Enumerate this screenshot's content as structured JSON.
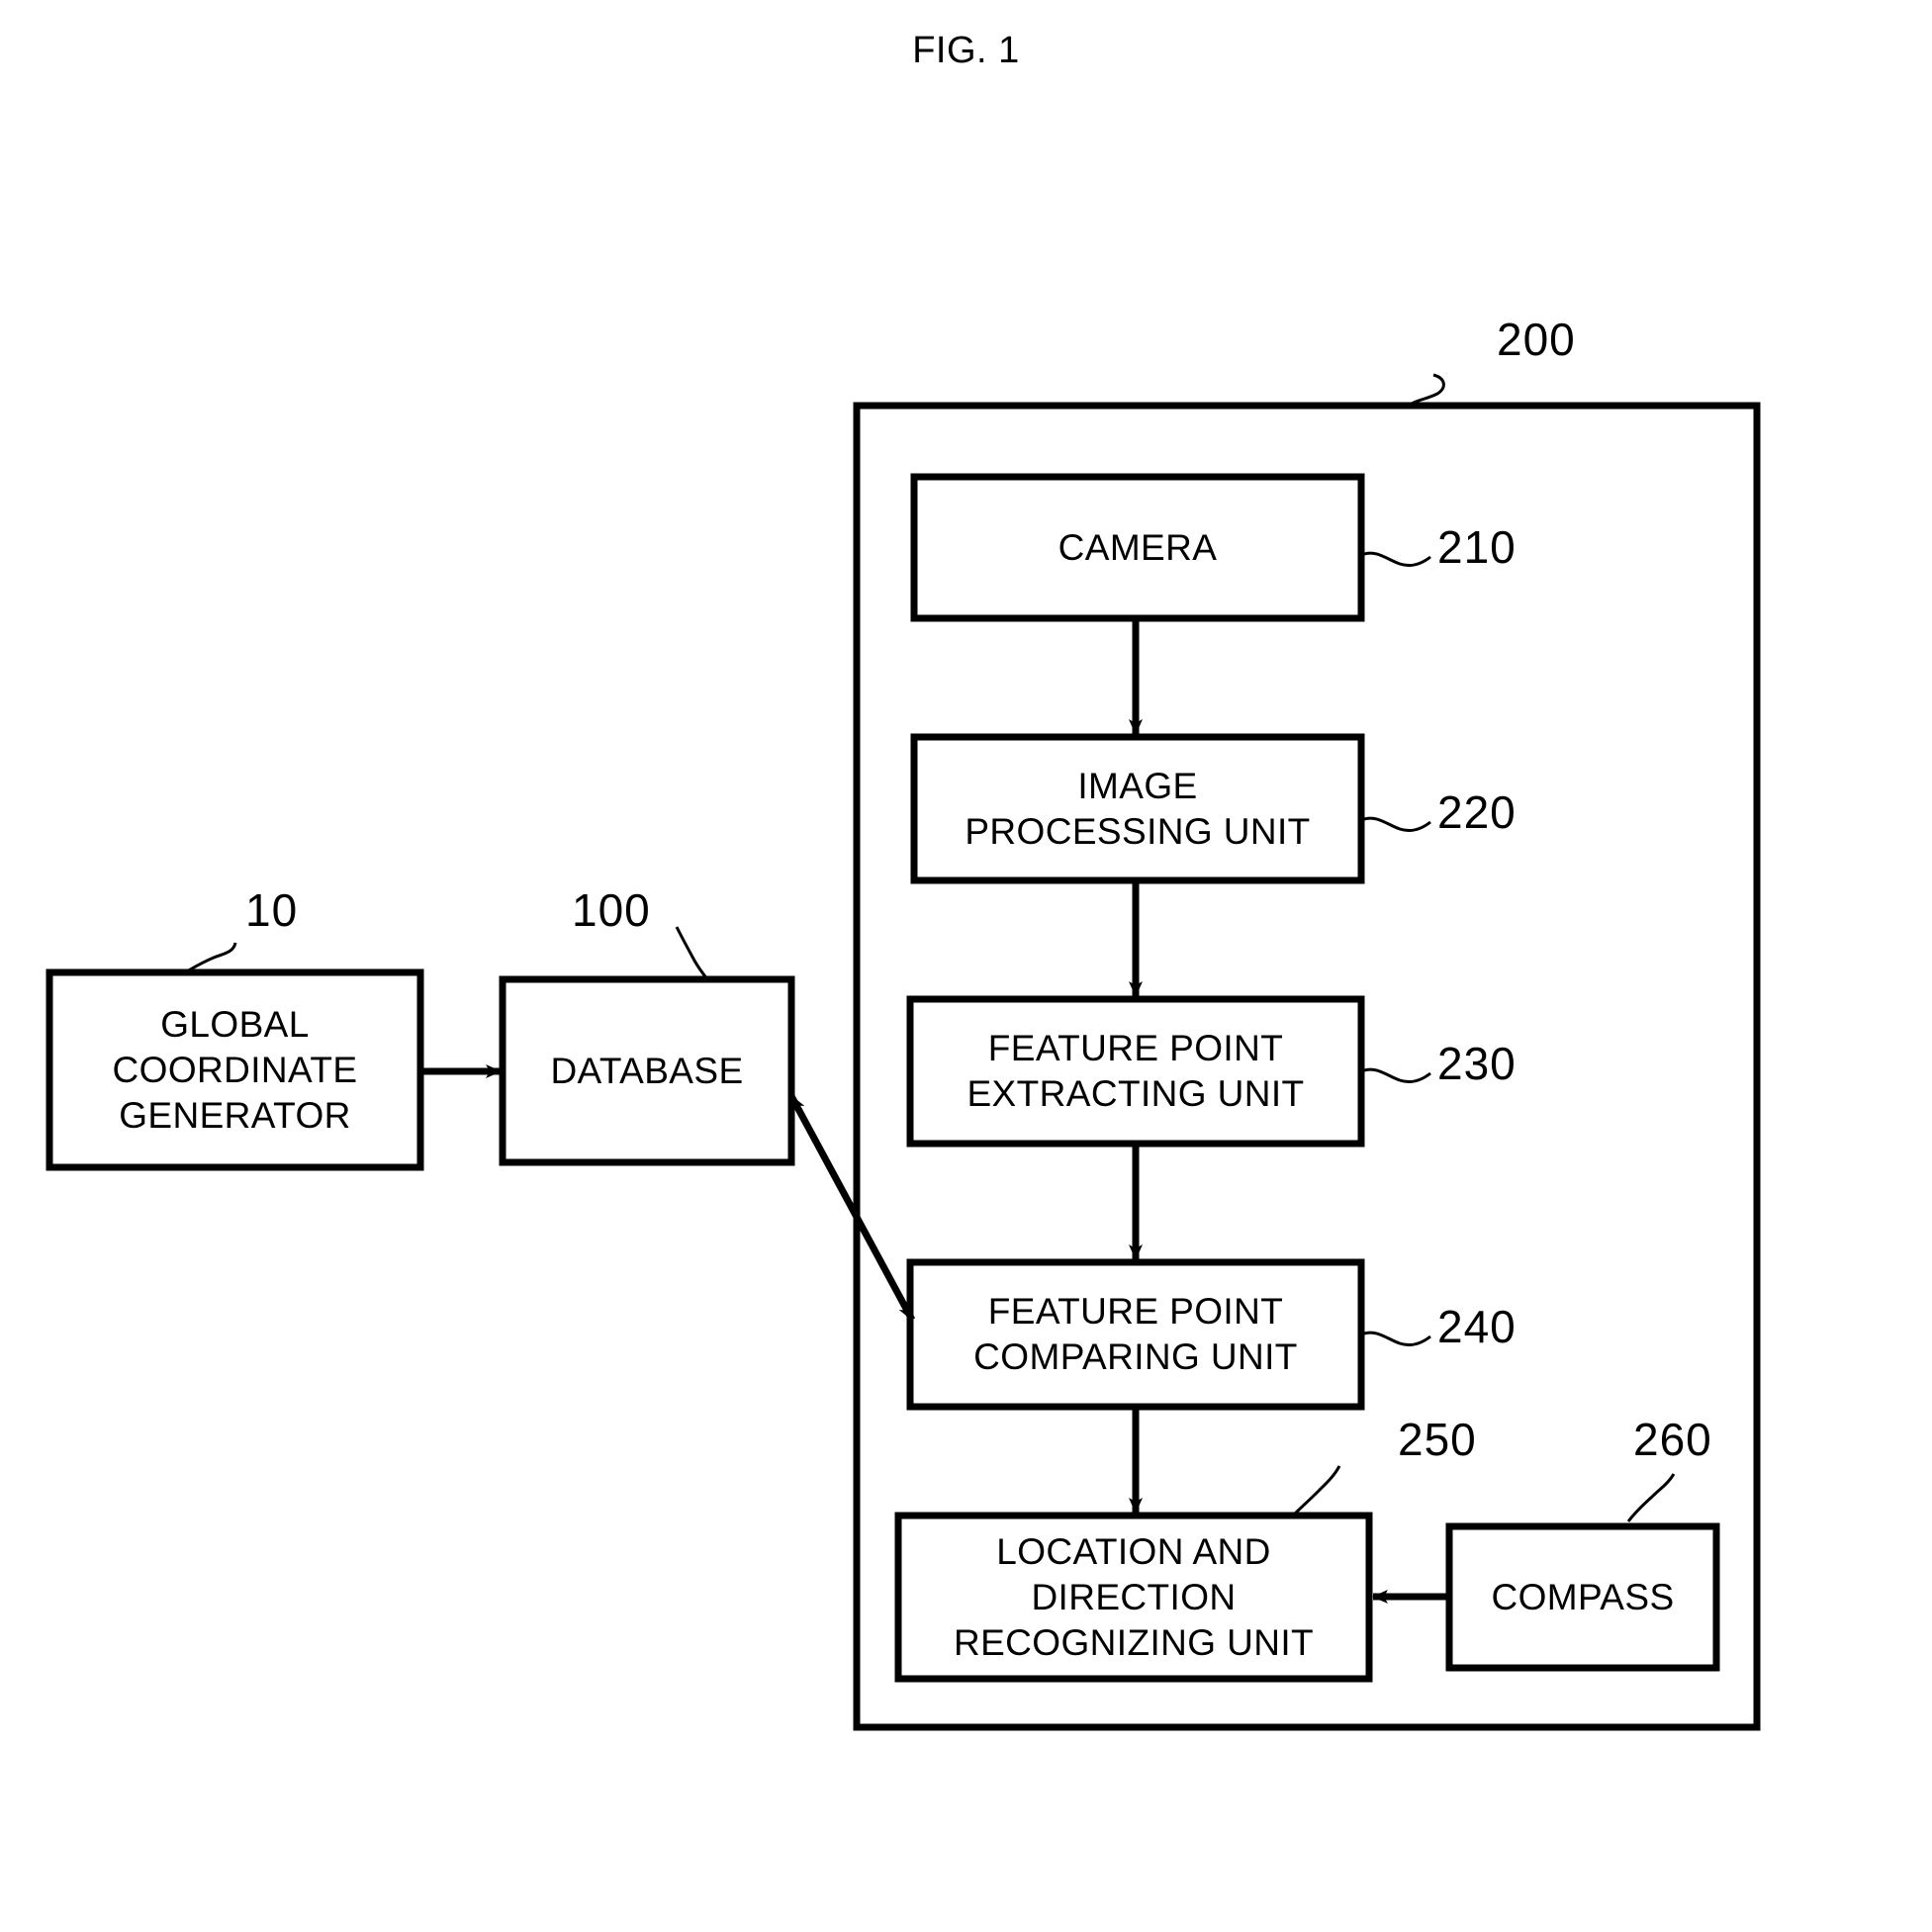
{
  "figure": {
    "title": "FIG. 1",
    "type": "patent-block-diagram"
  },
  "container": {
    "ref": "200",
    "label_name": "apparatus-enclosure"
  },
  "blocks": [
    {
      "id": "global-coordinate-generator",
      "text": "GLOBAL\nCOORDINATE\nGENERATOR",
      "ref": "10"
    },
    {
      "id": "database",
      "text": "DATABASE",
      "ref": "100"
    },
    {
      "id": "camera",
      "text": "CAMERA",
      "ref": "210"
    },
    {
      "id": "image-processing-unit",
      "text": "IMAGE\nPROCESSING UNIT",
      "ref": "220"
    },
    {
      "id": "feature-point-extracting-unit",
      "text": "FEATURE POINT\nEXTRACTING UNIT",
      "ref": "230"
    },
    {
      "id": "feature-point-comparing-unit",
      "text": "FEATURE POINT\nCOMPARING UNIT",
      "ref": "240"
    },
    {
      "id": "location-and-direction-recognizing-unit",
      "text": "LOCATION AND\nDIRECTION\nRECOGNIZING UNIT",
      "ref": "250"
    },
    {
      "id": "compass",
      "text": "COMPASS",
      "ref": "260"
    }
  ],
  "connections": [
    {
      "from": "global-coordinate-generator",
      "to": "database",
      "style": "single-arrow"
    },
    {
      "from": "database",
      "to": "feature-point-comparing-unit",
      "style": "double-arrow"
    },
    {
      "from": "camera",
      "to": "image-processing-unit",
      "style": "single-arrow"
    },
    {
      "from": "image-processing-unit",
      "to": "feature-point-extracting-unit",
      "style": "single-arrow"
    },
    {
      "from": "feature-point-extracting-unit",
      "to": "feature-point-comparing-unit",
      "style": "single-arrow"
    },
    {
      "from": "feature-point-comparing-unit",
      "to": "location-and-direction-recognizing-unit",
      "style": "single-arrow"
    },
    {
      "from": "compass",
      "to": "location-and-direction-recognizing-unit",
      "style": "single-arrow"
    }
  ],
  "colors": {
    "stroke": "#000000",
    "background": "#ffffff"
  }
}
